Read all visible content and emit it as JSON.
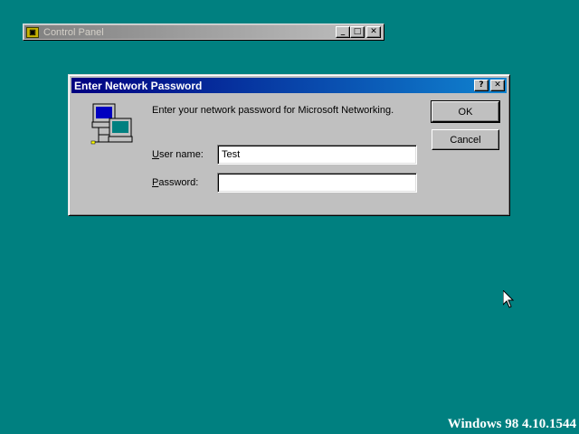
{
  "background_color": "#008080",
  "control_panel": {
    "title": "Control Panel",
    "icon": "control-panel-icon",
    "buttons": {
      "minimize": "_",
      "maximize": "□",
      "close": "✕"
    }
  },
  "dialog": {
    "title": "Enter Network Password",
    "titlebar_colors": [
      "#000080",
      "#1084d0"
    ],
    "help_button": "?",
    "close_button": "✕",
    "icon": "network-computers-icon",
    "prompt": "Enter your network password for Microsoft Networking.",
    "username": {
      "label_accel": "U",
      "label_rest": "ser name:",
      "value": "Test"
    },
    "password": {
      "label_accel": "P",
      "label_rest": "assword:",
      "value": ""
    },
    "ok_label": "OK",
    "cancel_label": "Cancel"
  },
  "watermark": "Windows 98 4.10.1544"
}
